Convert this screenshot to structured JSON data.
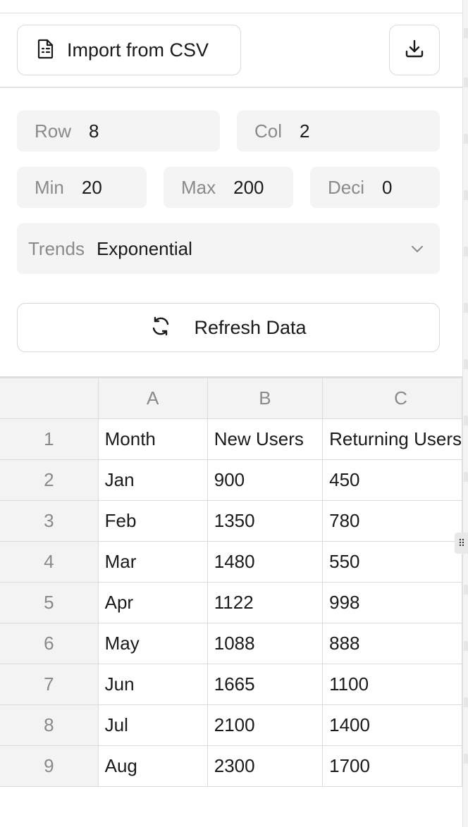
{
  "toolbar": {
    "import_label": "Import from CSV",
    "import_icon": "file-spreadsheet-icon",
    "download_icon": "download-icon"
  },
  "settings": {
    "row": {
      "label": "Row",
      "value": "8"
    },
    "col": {
      "label": "Col",
      "value": "2"
    },
    "min": {
      "label": "Min",
      "value": "20"
    },
    "max": {
      "label": "Max",
      "value": "200"
    },
    "deci": {
      "label": "Deci",
      "value": "0"
    },
    "trends": {
      "label": "Trends",
      "value": "Exponential"
    },
    "refresh_label": "Refresh Data",
    "refresh_icon": "refresh-icon"
  },
  "sheet": {
    "columns": [
      "A",
      "B",
      "C"
    ],
    "rows": [
      {
        "num": "1",
        "cells": [
          "Month",
          "New Users",
          "Returning Users"
        ]
      },
      {
        "num": "2",
        "cells": [
          "Jan",
          "900",
          "450"
        ]
      },
      {
        "num": "3",
        "cells": [
          "Feb",
          "1350",
          "780"
        ]
      },
      {
        "num": "4",
        "cells": [
          "Mar",
          "1480",
          "550"
        ]
      },
      {
        "num": "5",
        "cells": [
          "Apr",
          "1122",
          "998"
        ]
      },
      {
        "num": "6",
        "cells": [
          "May",
          "1088",
          "888"
        ]
      },
      {
        "num": "7",
        "cells": [
          "Jun",
          "1665",
          "1100"
        ]
      },
      {
        "num": "8",
        "cells": [
          "Jul",
          "2100",
          "1400"
        ]
      },
      {
        "num": "9",
        "cells": [
          "Aug",
          "2300",
          "1700"
        ]
      }
    ]
  }
}
